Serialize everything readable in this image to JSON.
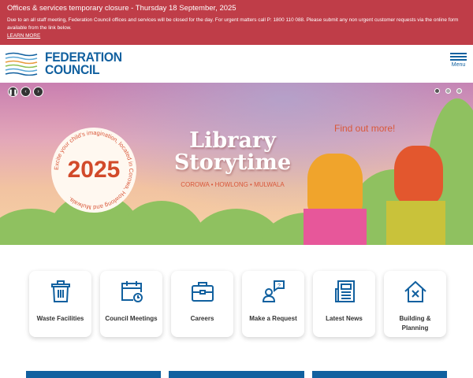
{
  "alert": {
    "title": "Offices & services temporary closure - Thursday 18 September, 2025",
    "body": "Due to an all staff meeting, Federation Council offices and services will be closed for the day. For urgent matters call P: 1800 110 088. Please submit any non urgent customer requests via the online form available from the link below.",
    "link": "LEARN MORE"
  },
  "header": {
    "logo_line1": "FEDERATION",
    "logo_line2": "COUNCIL",
    "menu_label": "Menu"
  },
  "hero": {
    "circle_year": "2025",
    "circle_text": "Excite your child's imagination, located in Corowa, Howlong and Mulwala.",
    "title_line1": "Library",
    "title_line2": "Storytime",
    "towns": "COROWA • HOWLONG • MULWALA",
    "cta": "Find out more!",
    "slides": 3,
    "active_slide": 1
  },
  "tiles": [
    {
      "label": "Waste Facilities",
      "icon": "trash-icon"
    },
    {
      "label": "Council Meetings",
      "icon": "calendar-clock-icon"
    },
    {
      "label": "Careers",
      "icon": "briefcase-icon"
    },
    {
      "label": "Make a Request",
      "icon": "person-question-icon"
    },
    {
      "label": "Latest News",
      "icon": "newspaper-icon"
    },
    {
      "label": "Building & Planning",
      "icon": "house-tools-icon"
    }
  ],
  "colors": {
    "alert": "#bf3d48",
    "brand": "#11609f"
  }
}
